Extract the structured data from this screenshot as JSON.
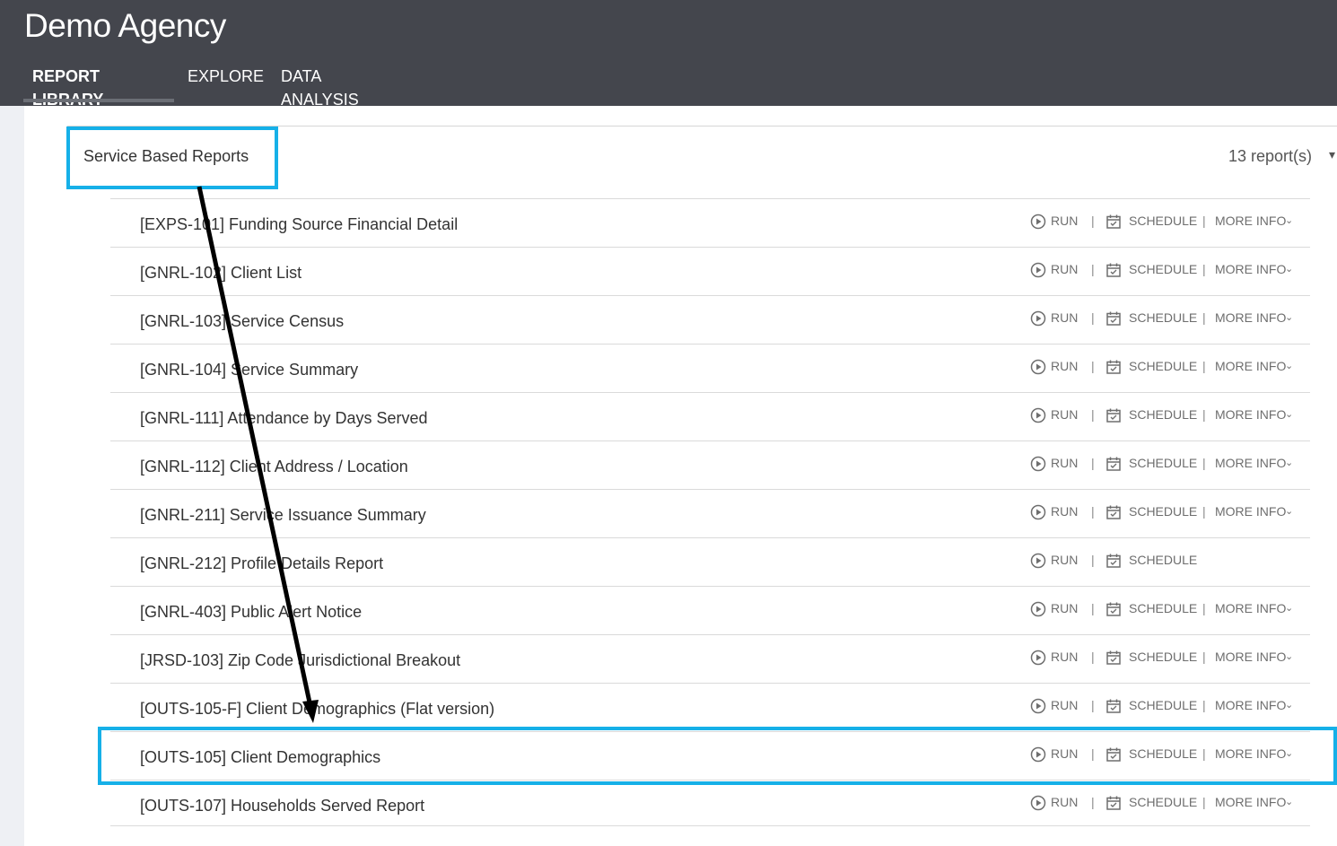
{
  "header": {
    "app_title": "Demo Agency",
    "tabs": [
      {
        "label": "REPORT LIBRARY",
        "active": true
      },
      {
        "label": "EXPLORE",
        "active": false
      },
      {
        "label": "DATA ANALYSIS",
        "active": false
      }
    ]
  },
  "section": {
    "title": "Service Based Reports",
    "count": "13 report(s)"
  },
  "actions": {
    "run": "RUN",
    "schedule": "SCHEDULE",
    "more_info": "MORE INFO",
    "separator": "|"
  },
  "reports": [
    {
      "name": "[EXPS-101] Funding Source Financial Detail",
      "more_info": true
    },
    {
      "name": "[GNRL-102] Client List",
      "more_info": true
    },
    {
      "name": "[GNRL-103] Service Census",
      "more_info": true
    },
    {
      "name": "[GNRL-104] Service Summary",
      "more_info": true
    },
    {
      "name": "[GNRL-111] Attendance by Days Served",
      "more_info": true
    },
    {
      "name": "[GNRL-112] Client Address / Location",
      "more_info": true
    },
    {
      "name": "[GNRL-211] Service Issuance Summary",
      "more_info": true
    },
    {
      "name": "[GNRL-212] Profile Details Report",
      "more_info": false
    },
    {
      "name": "[GNRL-403] Public Alert Notice",
      "more_info": true
    },
    {
      "name": "[JRSD-103] Zip Code Jurisdictional Breakout",
      "more_info": true
    },
    {
      "name": "[OUTS-105-F] Client Demographics (Flat version)",
      "more_info": true
    },
    {
      "name": "[OUTS-105] Client Demographics",
      "more_info": true
    },
    {
      "name": "[OUTS-107] Households Served Report",
      "more_info": true
    }
  ],
  "colors": {
    "header_bg": "#44464d",
    "highlight": "#16b0e8",
    "arrow": "#000000"
  }
}
